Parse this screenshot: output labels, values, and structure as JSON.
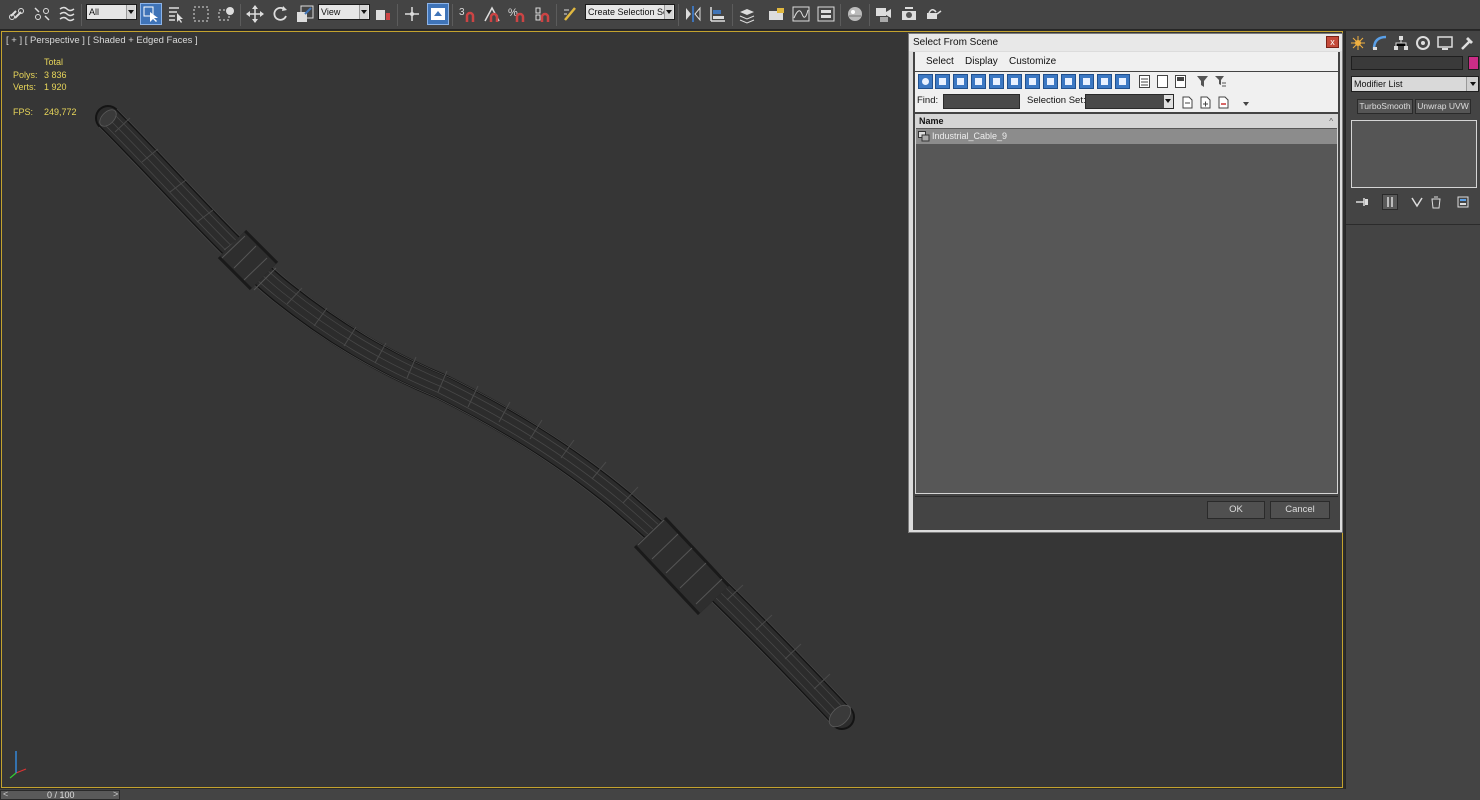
{
  "toolbar": {
    "filter_value": "All",
    "ref_coord_value": "View",
    "named_selection_value": "Create Selection Se",
    "snap_3_label": "3",
    "snap_percent_label": "%"
  },
  "viewport": {
    "label": "[ + ] [ Perspective ] [ Shaded + Edged Faces ]",
    "stats": {
      "total_label": "Total",
      "polys_label": "Polys:",
      "polys_value": "3 836",
      "verts_label": "Verts:",
      "verts_value": "1 920",
      "fps_label": "FPS:",
      "fps_value": "249,772"
    }
  },
  "timeline": {
    "frame_label": "0 / 100",
    "prev_glyph": "<",
    "next_glyph": ">"
  },
  "command_panel": {
    "object_color": "#cc2d87",
    "modifier_list_label": "Modifier List",
    "modifier_buttons": [
      "TurboSmooth",
      "Unwrap UVW"
    ]
  },
  "dialog": {
    "title": "Select From Scene",
    "close_glyph": "x",
    "menu": [
      "Select",
      "Display",
      "Customize"
    ],
    "find_label": "Find:",
    "selection_set_label": "Selection Set:",
    "list": {
      "column_header": "Name",
      "rows": [
        {
          "name": "Industrial_Cable_9"
        }
      ]
    },
    "ok_label": "OK",
    "cancel_label": "Cancel"
  }
}
